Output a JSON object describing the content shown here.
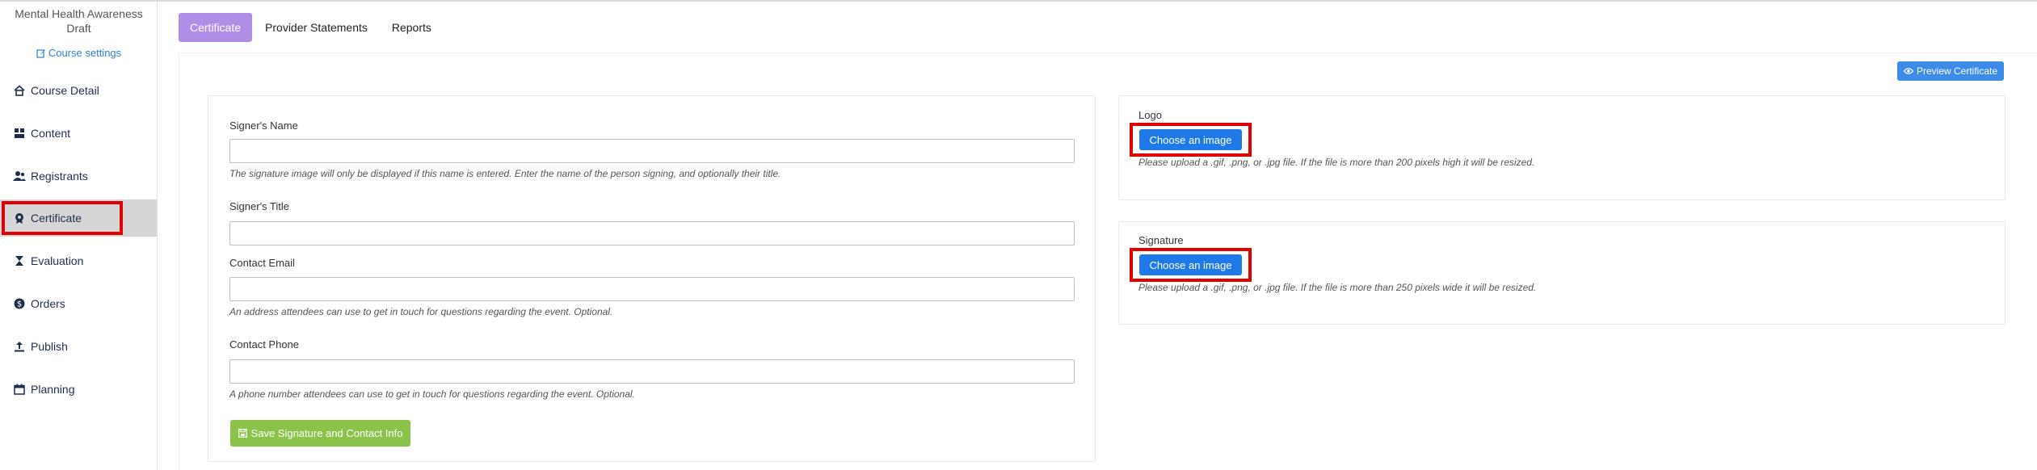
{
  "sidebar": {
    "course_title": "Mental Health Awareness",
    "course_status": "Draft",
    "course_settings": "Course settings",
    "items": [
      {
        "label": "Course Detail",
        "icon": "home-icon"
      },
      {
        "label": "Content",
        "icon": "content-blocks-icon"
      },
      {
        "label": "Registrants",
        "icon": "users-icon"
      },
      {
        "label": "Certificate",
        "icon": "award-icon"
      },
      {
        "label": "Evaluation",
        "icon": "hourglass-icon"
      },
      {
        "label": "Orders",
        "icon": "dollar-icon"
      },
      {
        "label": "Publish",
        "icon": "upload-icon"
      },
      {
        "label": "Planning",
        "icon": "calendar-icon"
      }
    ],
    "active_item": "Certificate"
  },
  "tabs": [
    {
      "label": "Certificate"
    },
    {
      "label": "Provider Statements"
    },
    {
      "label": "Reports"
    }
  ],
  "active_tab": "Certificate",
  "preview_button": "Preview Certificate",
  "form": {
    "signer_name": {
      "label": "Signer's Name",
      "value": "",
      "hint": "The signature image will only be displayed if this name is entered. Enter the name of the person signing, and optionally their title."
    },
    "signer_title": {
      "label": "Signer's Title",
      "value": ""
    },
    "contact_email": {
      "label": "Contact Email",
      "value": "",
      "hint": "An address attendees can use to get in touch for questions regarding the event. Optional."
    },
    "contact_phone": {
      "label": "Contact Phone",
      "value": "",
      "hint": "A phone number attendees can use to get in touch for questions regarding the event. Optional."
    },
    "save_button": "Save Signature and Contact Info"
  },
  "logo": {
    "label": "Logo",
    "button": "Choose an image",
    "hint": "Please upload a .gif, .png, or .jpg file. If the file is more than 200 pixels high it will be resized."
  },
  "signature": {
    "label": "Signature",
    "button": "Choose an image",
    "hint": "Please upload a .gif, .png, or .jpg file. If the file is more than 250 pixels wide it will be resized."
  },
  "colors": {
    "tab_active": "#b08ee8",
    "primary": "#1f7ae8",
    "success": "#8bc34a",
    "highlight": "#e00000",
    "sidebar_active": "#d6d6d6"
  }
}
